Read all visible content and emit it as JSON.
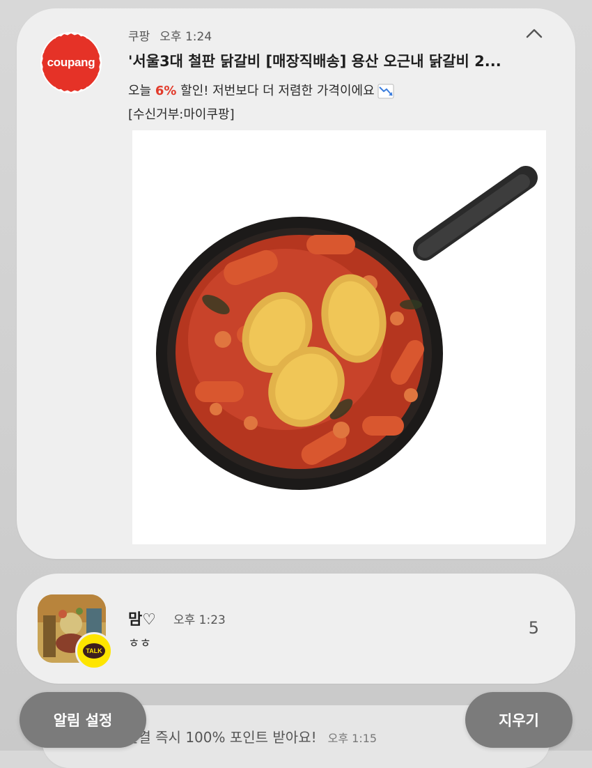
{
  "notification1": {
    "app_logo_text": "coupang",
    "app_name": "쿠팡",
    "time": "오후 1:24",
    "title": "'서울3대 철판 닭갈비 [매장직배송] 용산 오근내 닭갈비 2...",
    "line1_prefix": "오늘 ",
    "discount": "6%",
    "line1_suffix": " 할인! 저번보다 더 저렴한 가격이에요",
    "line2": "[수신거부:마이쿠팡]",
    "image_icon": "dakgalbi-pan-image"
  },
  "notification2": {
    "sender": "맘♡",
    "time": "오후 1:23",
    "message": "ㅎㅎ",
    "count": "5",
    "badge_text": "TALK"
  },
  "notification3": {
    "text": "연결 즉시 100% 포인트 받아요!",
    "time": "오후 1:15"
  },
  "buttons": {
    "notification_settings": "알림 설정",
    "clear": "지우기"
  },
  "colors": {
    "coupang_red": "#e53227",
    "discount_red": "#e23a2a",
    "kakao_yellow": "#fee500",
    "pill_gray": "#7b7b7b"
  }
}
